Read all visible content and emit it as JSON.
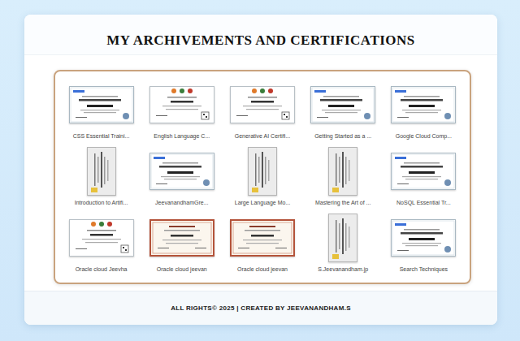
{
  "page": {
    "title": "MY ARCHIVEMENTS AND CERTIFICATIONS",
    "footer": "ALL RIGHTS© 2025 | CREATED BY JEEVANANDHAM.S"
  },
  "certificates": [
    {
      "caption": "CSS Essential Traini...",
      "kind": "plain"
    },
    {
      "caption": "English Language C...",
      "kind": "emblem"
    },
    {
      "caption": "Generative AI Certifi...",
      "kind": "emblem"
    },
    {
      "caption": "Getting Started as a ...",
      "kind": "plain"
    },
    {
      "caption": "Google Cloud Comp...",
      "kind": "plain"
    },
    {
      "caption": "Introduction to Artifi...",
      "kind": "portrait"
    },
    {
      "caption": "JeevanandhamGre...",
      "kind": "plain"
    },
    {
      "caption": "Large Language Mo...",
      "kind": "portrait"
    },
    {
      "caption": "Mastering the Art of ...",
      "kind": "portrait"
    },
    {
      "caption": "NoSQL Essential Tr...",
      "kind": "plain"
    },
    {
      "caption": "Oracle cloud Jeevha",
      "kind": "emblem"
    },
    {
      "caption": "Oracle cloud jeevan",
      "kind": "framed"
    },
    {
      "caption": "Oracle cloud jeevan",
      "kind": "framed"
    },
    {
      "caption": "S.Jeevanandham.jp",
      "kind": "portrait"
    },
    {
      "caption": "Search Techniques",
      "kind": "plain"
    }
  ]
}
